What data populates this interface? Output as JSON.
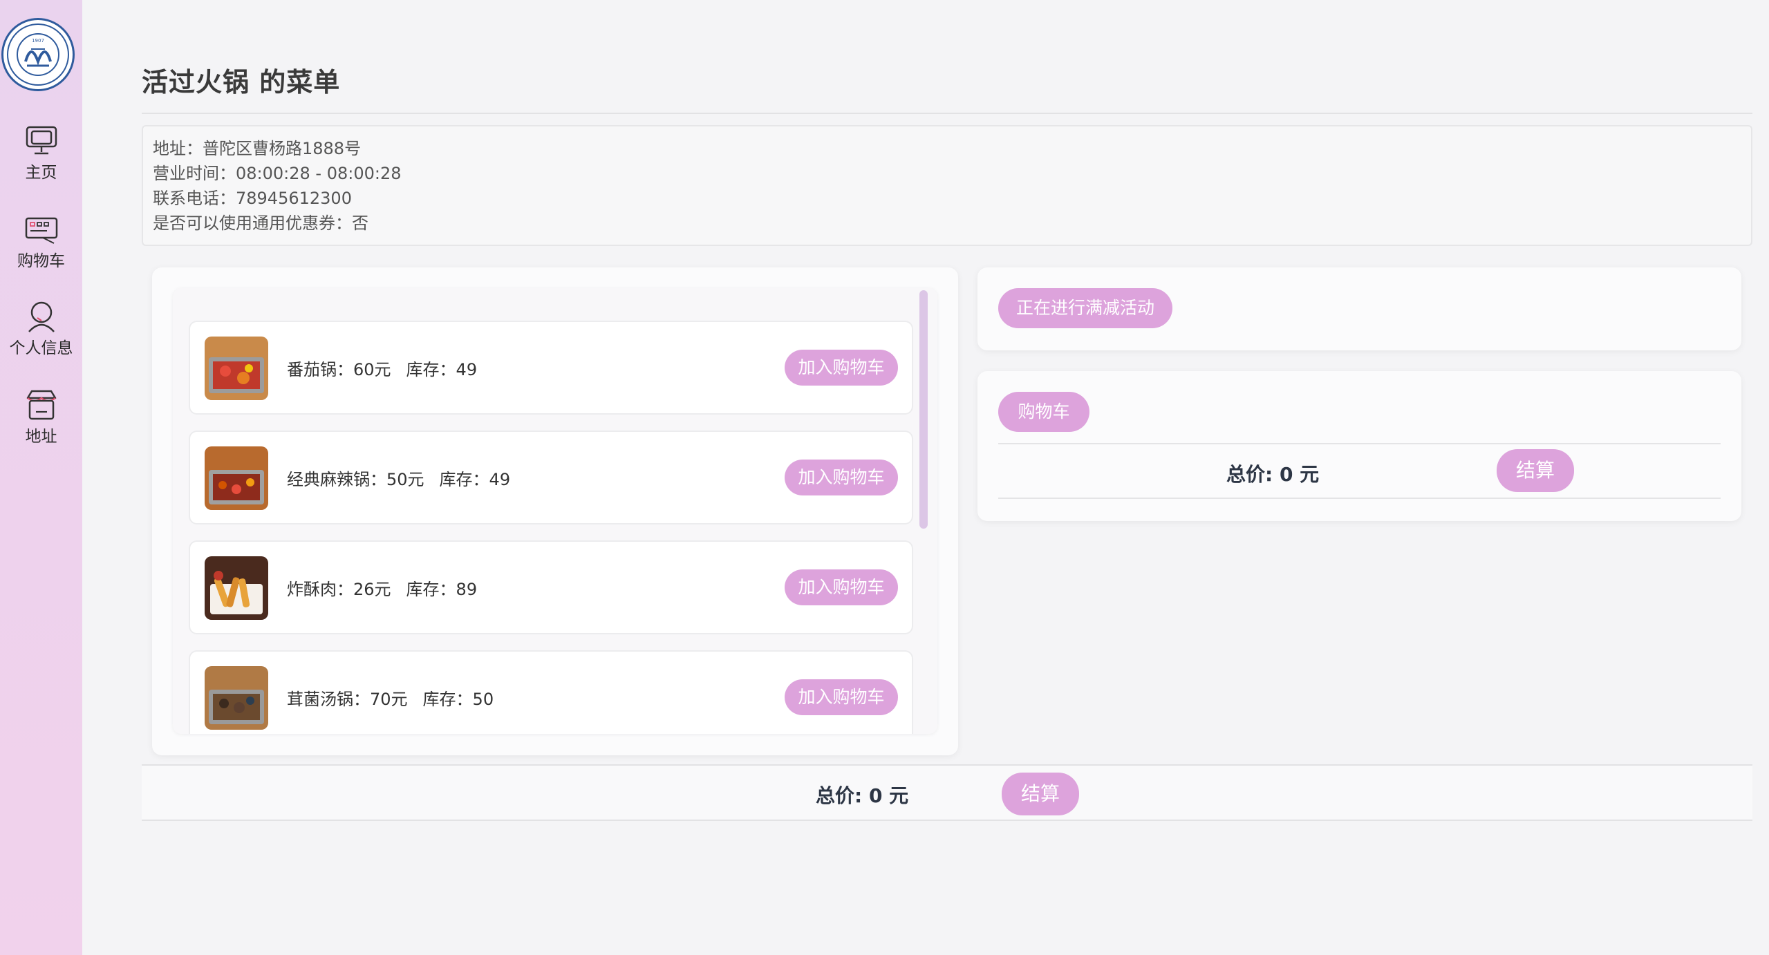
{
  "sidebar": {
    "logo_alt": "TONGJI UNIVERSITY 1907",
    "items": [
      {
        "label": "主页",
        "icon": "home-monitor-icon"
      },
      {
        "label": "购物车",
        "icon": "cart-keyboard-icon"
      },
      {
        "label": "个人信息",
        "icon": "user-icon"
      },
      {
        "label": "地址",
        "icon": "store-icon"
      }
    ]
  },
  "page": {
    "title": "活过火锅 的菜单"
  },
  "restaurant": {
    "address": "地址：普陀区曹杨路1888号",
    "hours": "营业时间：08:00:28 - 08:00:28",
    "phone": "联系电话：78945612300",
    "coupon": "是否可以使用通用优惠券：否"
  },
  "menu": {
    "add_label": "加入购物车",
    "dishes": [
      {
        "name": "番茄锅：60元",
        "stock": "库存：49",
        "image": "tomato-hotpot"
      },
      {
        "name": "经典麻辣锅：50元",
        "stock": "库存：49",
        "image": "spicy-hotpot"
      },
      {
        "name": "炸酥肉：26元",
        "stock": "库存：89",
        "image": "fried-pork"
      },
      {
        "name": "茸菌汤锅：70元",
        "stock": "库存：50",
        "image": "mushroom-hotpot"
      }
    ]
  },
  "promo": {
    "button_label": "正在进行满减活动"
  },
  "cart": {
    "button_label": "购物车",
    "total": "总价: 0 元",
    "checkout_label": "结算"
  },
  "footer": {
    "total": "总价: 0 元",
    "checkout_label": "结算"
  },
  "colors": {
    "accent": "#dda3dc",
    "sidebar": "#ead3ee",
    "background": "#f4f4f6"
  }
}
